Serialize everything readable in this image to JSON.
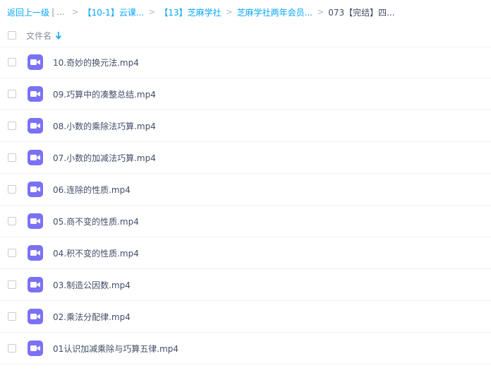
{
  "breadcrumb": {
    "back_label": "返回上一级",
    "divider": "|",
    "ellipsis": "...",
    "sep": ">",
    "items": [
      {
        "label": "【10-1】云课..."
      },
      {
        "label": "【13】芝麻学社"
      },
      {
        "label": "芝麻学社两年会员..."
      }
    ],
    "current": "073【完结】四..."
  },
  "list_header": {
    "column_label": "文件名",
    "sort_icon": "arrow-down-icon"
  },
  "files": [
    {
      "name": "10.奇妙的换元法.mp4",
      "icon": "video-file-icon"
    },
    {
      "name": "09.巧算中的凑整总结.mp4",
      "icon": "video-file-icon"
    },
    {
      "name": "08.小数的乘除法巧算.mp4",
      "icon": "video-file-icon"
    },
    {
      "name": "07.小数的加减法巧算.mp4",
      "icon": "video-file-icon"
    },
    {
      "name": "06.连除的性质.mp4",
      "icon": "video-file-icon"
    },
    {
      "name": "05.商不变的性质.mp4",
      "icon": "video-file-icon"
    },
    {
      "name": "04.积不变的性质.mp4",
      "icon": "video-file-icon"
    },
    {
      "name": "03.制造公因数.mp4",
      "icon": "video-file-icon"
    },
    {
      "name": "02.乘法分配律.mp4",
      "icon": "video-file-icon"
    },
    {
      "name": "01认识加减乘除与巧算五律.mp4",
      "icon": "video-file-icon"
    }
  ],
  "colors": {
    "link": "#06a7ff",
    "video_icon": "#7b71f4",
    "text": "#424e67",
    "muted": "#878c9c"
  }
}
